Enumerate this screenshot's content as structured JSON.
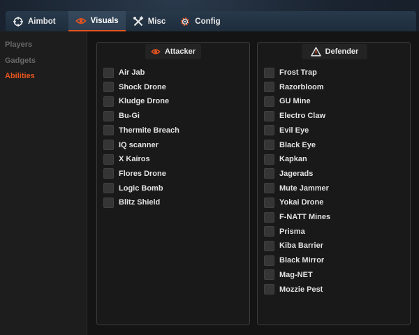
{
  "tabs": [
    {
      "label": "Aimbot",
      "icon": "crosshair-icon"
    },
    {
      "label": "Visuals",
      "icon": "eye-icon",
      "active": true
    },
    {
      "label": "Misc",
      "icon": "tools-icon"
    },
    {
      "label": "Config",
      "icon": "gear-icon"
    }
  ],
  "sidebar": {
    "items": [
      {
        "label": "Players"
      },
      {
        "label": "Gadgets"
      },
      {
        "label": "Abilities",
        "active": true
      }
    ]
  },
  "attacker": {
    "title": "Attacker",
    "icon": "eye-icon",
    "items": [
      "Air Jab",
      "Shock Drone",
      "Kludge Drone",
      "Bu-Gi",
      "Thermite Breach",
      "IQ scanner",
      "X Kairos",
      "Flores Drone",
      "Logic Bomb",
      "Blitz Shield"
    ]
  },
  "defender": {
    "title": "Defender",
    "icon": "warning-triangle-icon",
    "items": [
      "Frost Trap",
      "Razorbloom",
      "GU Mine",
      "Electro Claw",
      "Evil Eye",
      "Black Eye",
      "Kapkan",
      "Jagerads",
      "Mute Jammer",
      "Yokai Drone",
      "F-NATT Mines",
      "Prisma",
      "Kiba Barrier",
      "Black Mirror",
      "Mag-NET",
      "Mozzie Pest"
    ]
  },
  "colors": {
    "accent": "#e8551f",
    "checkbox": "#353535",
    "panel_border": "#3c3c3c"
  }
}
